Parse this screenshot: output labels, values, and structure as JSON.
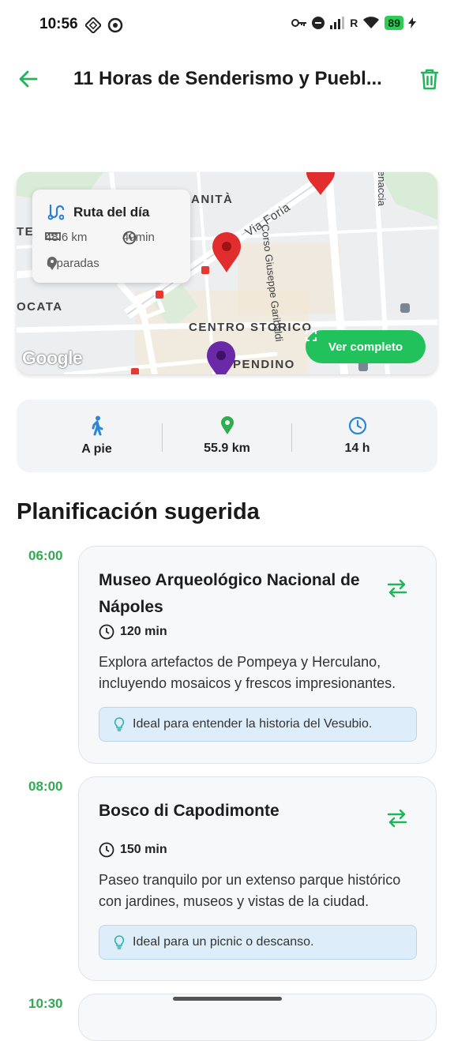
{
  "status_bar": {
    "time": "10:56",
    "battery": "89",
    "network": "R"
  },
  "header": {
    "title": "11 Horas de Senderismo y Puebl...",
    "back_icon": "arrow-left-icon",
    "delete_icon": "trash-icon"
  },
  "map": {
    "labels": [
      "ANITÀ",
      "VIA FORIA",
      "CORSO GIUSEPPE GARIBALDI",
      "ENACCIA",
      "TE",
      "OCATA",
      "CENTRO STORICO",
      "PENDINO"
    ],
    "label_text": {
      "anita": "ANITÀ",
      "via_foria": "Via Foria",
      "garibaldi": "Corso Giuseppe Garibaldi",
      "enaccia": "enaccia",
      "te": "TE",
      "ocata": "OCATA",
      "centro_storico": "CENTRO STORICO",
      "pendino": "PENDINO"
    },
    "google_logo": "Google",
    "route_card": {
      "title": "Ruta del día",
      "distance": "48.6 km",
      "duration": "49min",
      "stops": "6 paradas"
    },
    "view_full_button": "Ver completo",
    "colors": {
      "pin_red": "#e12d2d",
      "pin_purple": "#6a2aa8",
      "button": "#21c25c"
    }
  },
  "stats": [
    {
      "icon": "walking-icon",
      "label": "A pie"
    },
    {
      "icon": "location-pin-icon",
      "label": "55.9 km"
    },
    {
      "icon": "clock-icon",
      "label": "14 h"
    }
  ],
  "section_title": "Planificación sugerida",
  "plan": [
    {
      "time": "06:00",
      "name": "Museo Arqueológico Nacional de Nápoles",
      "duration": "120 min",
      "description": "Explora artefactos de Pompeya y Herculano, incluyendo mosaicos y frescos impresionantes.",
      "tip": "Ideal para entender la historia del Vesubio."
    },
    {
      "time": "08:00",
      "name": "Bosco di Capodimonte",
      "duration": "150 min",
      "description": "Paseo tranquilo por un extenso parque histórico con jardines, museos y vistas de la ciudad.",
      "tip": "Ideal para un picnic o descanso."
    },
    {
      "time": "10:30"
    }
  ],
  "accent_color": "#34a853"
}
